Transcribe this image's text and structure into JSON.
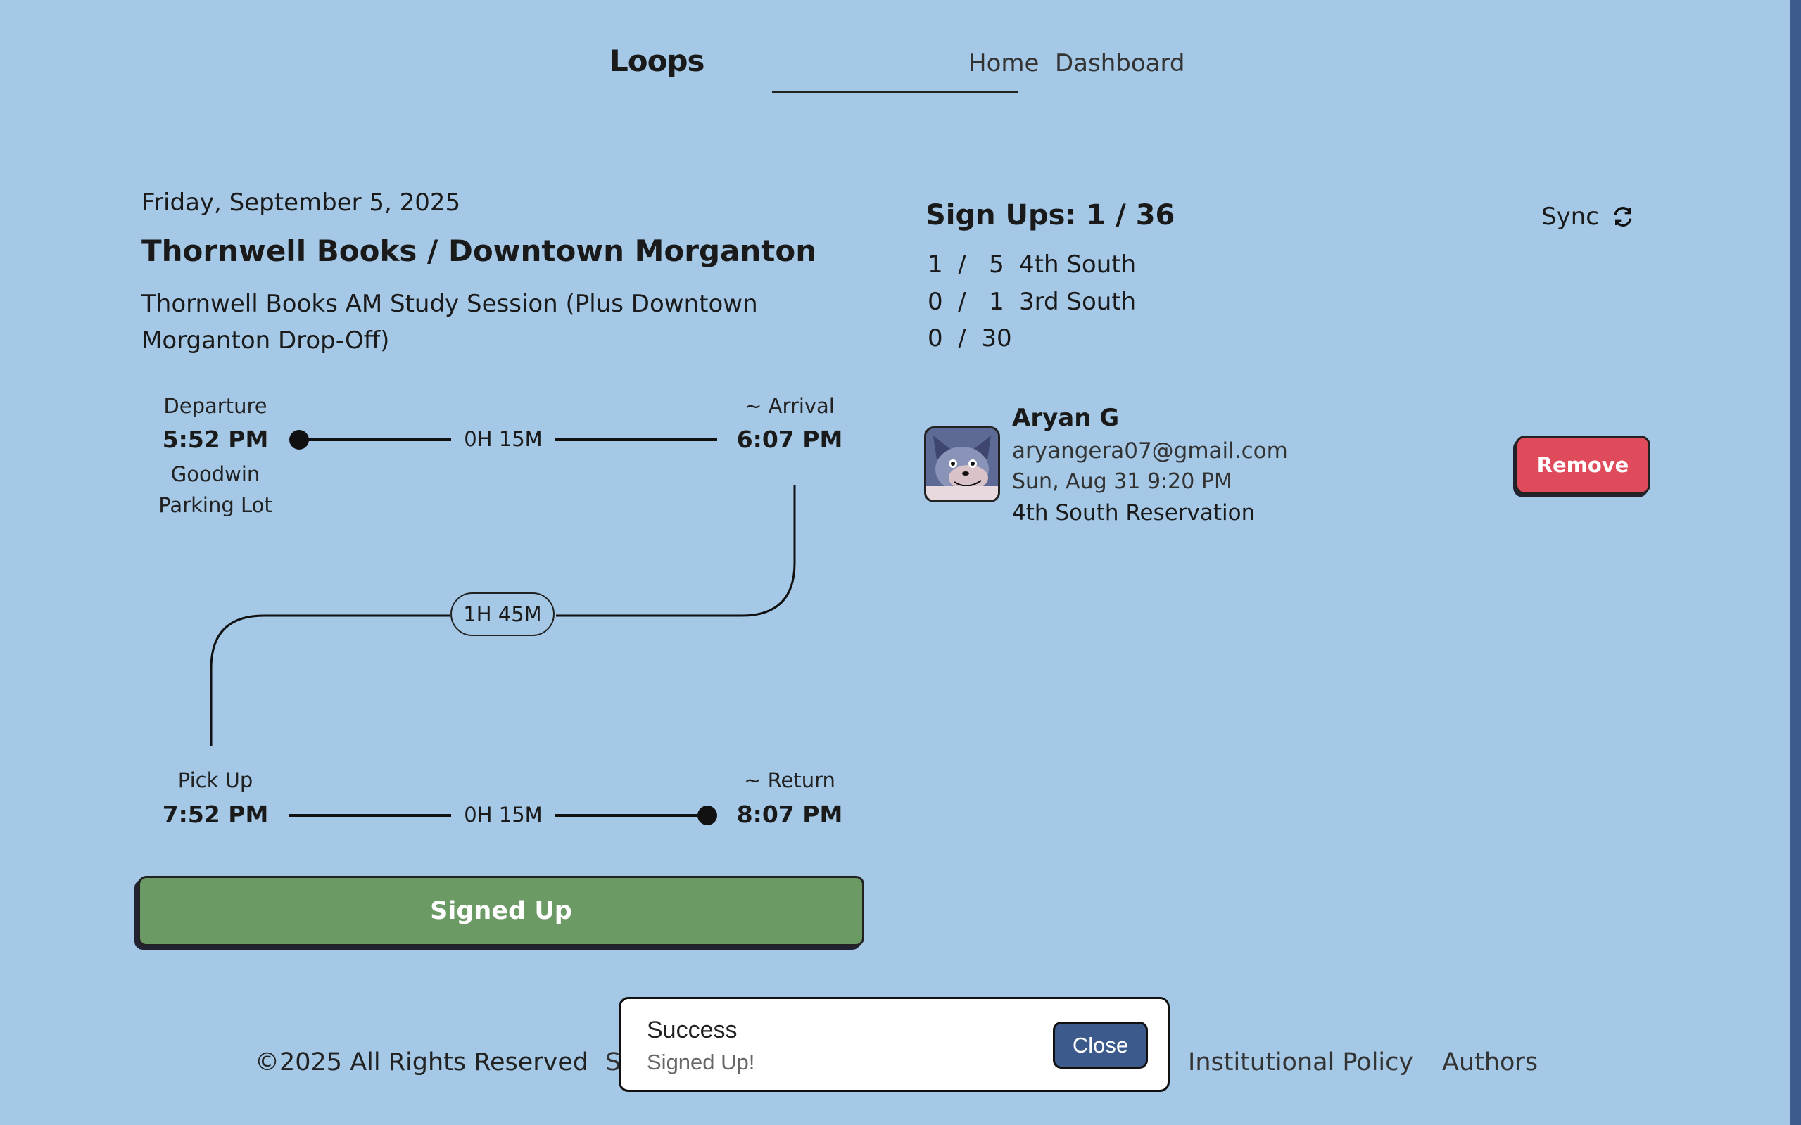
{
  "header": {
    "logo": "Loops",
    "nav": {
      "home": "Home",
      "dashboard": "Dashboard"
    }
  },
  "trip": {
    "date": "Friday, September 5, 2025",
    "title": "Thornwell Books / Downtown Morganton",
    "description": "Thornwell Books AM Study Session (Plus Downtown Morganton Drop-Off)",
    "outbound": {
      "departure_label": "Departure",
      "departure_time": "5:52 PM",
      "departure_location": "Goodwin Parking Lot",
      "duration": "0H 15M",
      "arrival_label": "~ Arrival",
      "arrival_time": "6:07 PM"
    },
    "stay_duration": "1H 45M",
    "return": {
      "pickup_label": "Pick Up",
      "pickup_time": "7:52 PM",
      "duration": "0H 15M",
      "return_label": "~ Return",
      "return_time": "8:07 PM"
    },
    "signed_up_button": "Signed Up"
  },
  "signups": {
    "title": "Sign Ups: 1 / 36",
    "sync_label": "Sync",
    "rows": [
      {
        "count": "1  /   5",
        "label": "4th South"
      },
      {
        "count": "0  /   1",
        "label": "3rd South"
      },
      {
        "count": "0  /  30",
        "label": ""
      }
    ],
    "users": [
      {
        "name": "Aryan G",
        "email": "aryangera07@gmail.com",
        "date": "Sun, Aug 31 9:20 PM",
        "reservation": "4th South Reservation",
        "remove_label": "Remove"
      }
    ]
  },
  "footer": {
    "copyright": "©2025 All Rights Reserved",
    "partial_link": "S",
    "institutional_policy": "Institutional Policy",
    "authors": "Authors"
  },
  "toast": {
    "title": "Success",
    "message": "Signed Up!",
    "close_label": "Close"
  },
  "colors": {
    "background": "#a4c8e5",
    "signed_up_button": "#6b9a65",
    "remove_button": "#e04b5c",
    "close_button": "#3c5a8c"
  }
}
